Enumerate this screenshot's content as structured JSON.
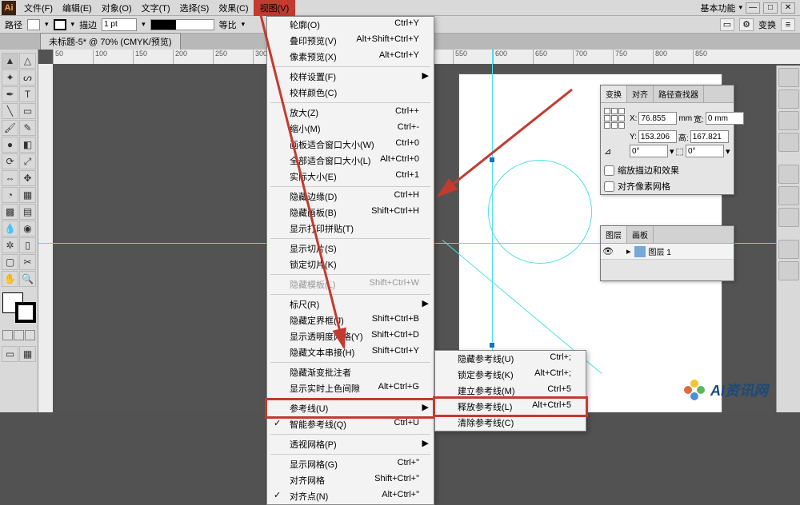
{
  "menubar": {
    "items": [
      "文件(F)",
      "编辑(E)",
      "对象(O)",
      "文字(T)",
      "选择(S)",
      "效果(C)",
      "视图(V)"
    ],
    "right_label": "基本功能",
    "highlight_index": 6
  },
  "controlbar": {
    "label1": "路径",
    "stroke_label": "描边",
    "stroke_value": "1 pt",
    "style_label": "等比",
    "transform_btn": "变换"
  },
  "doc_tab": "未标题-5* @ 70% (CMYK/预览)",
  "ruler_marks": [
    "50",
    "100",
    "150",
    "200",
    "250",
    "300",
    "",
    "",
    "",
    "",
    "",
    "550",
    "600",
    "650",
    "700",
    "750",
    "800",
    "850"
  ],
  "view_menu": [
    {
      "label": "轮廓(O)",
      "sc": "Ctrl+Y"
    },
    {
      "label": "叠印预览(V)",
      "sc": "Alt+Shift+Ctrl+Y"
    },
    {
      "label": "像素预览(X)",
      "sc": "Alt+Ctrl+Y"
    },
    {
      "sep": true
    },
    {
      "label": "校样设置(F)",
      "arrow": true
    },
    {
      "label": "校样颜色(C)"
    },
    {
      "sep": true
    },
    {
      "label": "放大(Z)",
      "sc": "Ctrl++"
    },
    {
      "label": "缩小(M)",
      "sc": "Ctrl+-"
    },
    {
      "label": "画板适合窗口大小(W)",
      "sc": "Ctrl+0"
    },
    {
      "label": "全部适合窗口大小(L)",
      "sc": "Alt+Ctrl+0"
    },
    {
      "label": "实际大小(E)",
      "sc": "Ctrl+1"
    },
    {
      "sep": true
    },
    {
      "label": "隐藏边缘(D)",
      "sc": "Ctrl+H"
    },
    {
      "label": "隐藏画板(B)",
      "sc": "Shift+Ctrl+H"
    },
    {
      "label": "显示打印拼贴(T)"
    },
    {
      "sep": true
    },
    {
      "label": "显示切片(S)"
    },
    {
      "label": "锁定切片(K)"
    },
    {
      "sep": true
    },
    {
      "label": "隐藏模板(L)",
      "sc": "Shift+Ctrl+W",
      "disabled": true
    },
    {
      "sep": true
    },
    {
      "label": "标尺(R)",
      "arrow": true
    },
    {
      "label": "隐藏定界框(J)",
      "sc": "Shift+Ctrl+B"
    },
    {
      "label": "显示透明度网格(Y)",
      "sc": "Shift+Ctrl+D"
    },
    {
      "label": "隐藏文本串接(H)",
      "sc": "Shift+Ctrl+Y"
    },
    {
      "sep": true
    },
    {
      "label": "隐藏渐变批注者"
    },
    {
      "label": "显示实时上色间隙",
      "sc": "Alt+Ctrl+G"
    },
    {
      "sep": true
    },
    {
      "label": "参考线(U)",
      "arrow": true,
      "hl": true
    },
    {
      "label": "智能参考线(Q)",
      "sc": "Ctrl+U",
      "check": true
    },
    {
      "sep": true
    },
    {
      "label": "透视网格(P)",
      "arrow": true
    },
    {
      "sep": true
    },
    {
      "label": "显示网格(G)",
      "sc": "Ctrl+\""
    },
    {
      "label": "对齐网格",
      "sc": "Shift+Ctrl+\""
    },
    {
      "label": "对齐点(N)",
      "sc": "Alt+Ctrl+\"",
      "check": true
    }
  ],
  "submenu": [
    {
      "label": "隐藏参考线(U)",
      "sc": "Ctrl+;"
    },
    {
      "label": "锁定参考线(K)",
      "sc": "Alt+Ctrl+;"
    },
    {
      "label": "建立参考线(M)",
      "sc": "Ctrl+5"
    },
    {
      "label": "释放参考线(L)",
      "sc": "Alt+Ctrl+5",
      "hl": true
    },
    {
      "label": "清除参考线(C)"
    }
  ],
  "transform_panel": {
    "tabs": [
      "变换",
      "对齐",
      "路径查找器"
    ],
    "x_label": "X:",
    "x_value": "76.855",
    "x_unit": "mm",
    "w_label": "宽:",
    "w_value": "0 mm",
    "y_label": "Y:",
    "y_value": "153.206",
    "h_label": "高:",
    "h_value": "167.821",
    "angle1": "0°",
    "angle2": "0°",
    "check1": "缩放描边和效果",
    "check2": "对齐像素网格"
  },
  "layers_panel": {
    "tabs": [
      "图层",
      "画板"
    ],
    "layer_name": "图层 1"
  },
  "watermark_text": "AI资讯网"
}
